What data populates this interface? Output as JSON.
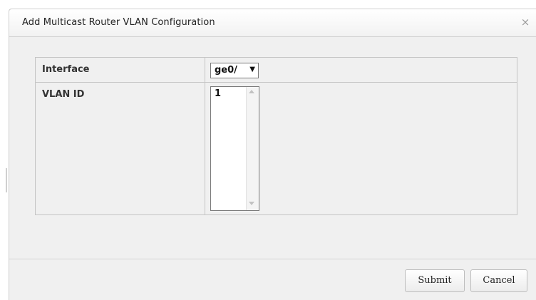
{
  "dialog": {
    "title": "Add Multicast Router VLAN Configuration",
    "close_icon": "×"
  },
  "form": {
    "interface_label": "Interface",
    "interface_value": "ge0/",
    "dropdown_arrow": "▼",
    "vlan_label": "VLAN ID",
    "vlan_list": [
      "1"
    ]
  },
  "buttons": {
    "submit_label": "Submit",
    "cancel_label": "Cancel"
  },
  "icons": {
    "close": "close-icon",
    "dropdown": "chevron-down-icon",
    "scroll_up": "scroll-up-arrow-icon",
    "scroll_down": "scroll-down-arrow-icon"
  }
}
